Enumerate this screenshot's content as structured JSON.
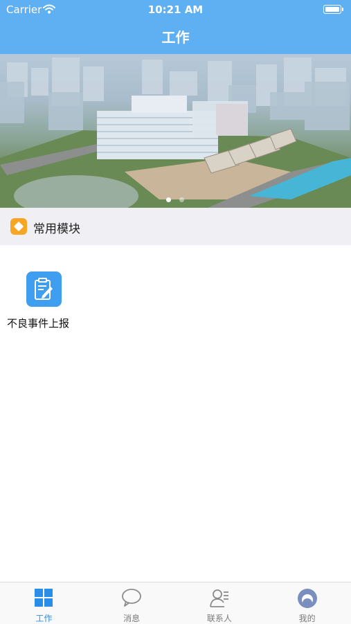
{
  "status_bar": {
    "carrier": "Carrier",
    "time": "10:21 AM"
  },
  "nav": {
    "title": "工作"
  },
  "banner": {
    "page_count": 2,
    "current_page": 1
  },
  "section": {
    "title": "常用模块",
    "icon": "diamond-badge-icon",
    "accent": "#f6a623"
  },
  "modules": [
    {
      "label": "不良事件上报",
      "icon": "edit-report-icon",
      "color": "#3f9ef0"
    }
  ],
  "tabbar": {
    "active_color": "#2a8ee8",
    "inactive_color": "#7a7a7a",
    "tabs": [
      {
        "label": "工作",
        "icon": "grid-icon",
        "active": true
      },
      {
        "label": "消息",
        "icon": "chat-bubble-icon",
        "active": false
      },
      {
        "label": "联系人",
        "icon": "contacts-icon",
        "active": false
      },
      {
        "label": "我的",
        "icon": "profile-avatar-icon",
        "active": false
      }
    ]
  },
  "colors": {
    "header": "#5fb0f3",
    "section_bg": "#efeff4"
  }
}
